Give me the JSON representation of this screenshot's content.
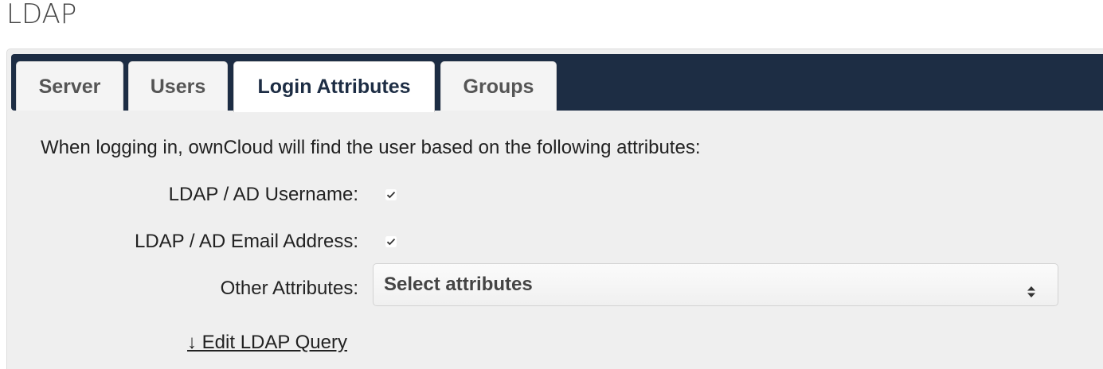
{
  "page": {
    "title": "LDAP"
  },
  "tabs": [
    {
      "label": "Server",
      "active": false
    },
    {
      "label": "Users",
      "active": false
    },
    {
      "label": "Login Attributes",
      "active": true
    },
    {
      "label": "Groups",
      "active": false
    }
  ],
  "login_attributes": {
    "intro": "When logging in, ownCloud will find the user based on the following attributes:",
    "username_label": "LDAP / AD Username:",
    "username_checked": true,
    "email_label": "LDAP / AD Email Address:",
    "email_checked": true,
    "other_label": "Other Attributes:",
    "other_placeholder": "Select attributes",
    "edit_query_link": "↓ Edit LDAP Query"
  },
  "colors": {
    "tabbar_background": "#1d2d44",
    "panel_background": "#efefef",
    "active_tab_text": "#1d2d44"
  },
  "icons": {
    "checkbox": "checkmark-icon",
    "select_arrows": "sort-arrows-icon"
  }
}
